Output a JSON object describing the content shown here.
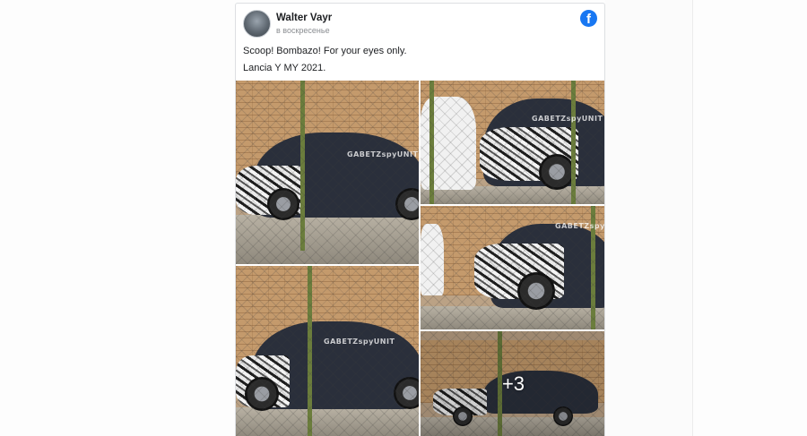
{
  "post": {
    "author": "Walter Vayr",
    "date": "в воскресенье",
    "platform_icon": "facebook-icon",
    "text_line_1": "Scoop! Bombazo! For your eyes only.",
    "text_line_2": "Lancia Y MY 2021."
  },
  "gallery": {
    "watermark": "GABETZspyUNIT",
    "more_count": "+3"
  },
  "colors": {
    "facebook_blue": "#1877f2",
    "car_body": "#2a2f3b",
    "brick": "#c49a6c"
  }
}
